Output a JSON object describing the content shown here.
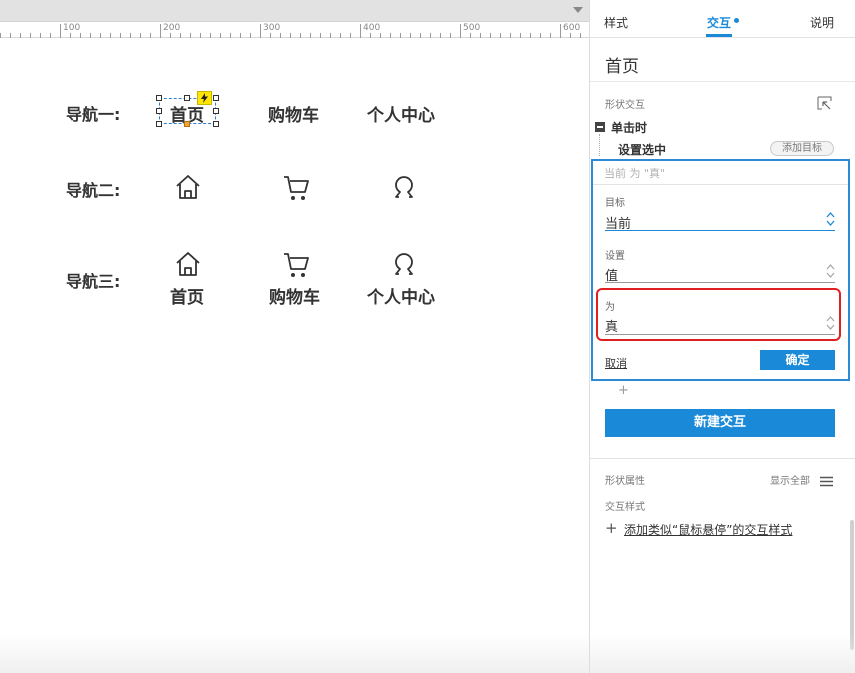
{
  "ruler": {
    "labels": [
      "100",
      "200",
      "300",
      "400",
      "500",
      "600"
    ]
  },
  "canvas": {
    "rows": [
      {
        "label": "导航一:",
        "items": [
          "首页",
          "购物车",
          "个人中心"
        ]
      },
      {
        "label": "导航二:",
        "icons": [
          "home-icon",
          "cart-icon",
          "user-icon"
        ]
      },
      {
        "label": "导航三:",
        "icons": [
          "home-icon",
          "cart-icon",
          "user-icon"
        ],
        "items": [
          "首页",
          "购物车",
          "个人中心"
        ]
      }
    ]
  },
  "panel": {
    "tabs": [
      "样式",
      "交互",
      "说明"
    ],
    "active_tab": "交互",
    "page_title": "首页",
    "shape_interactions_label": "形状交互",
    "event": {
      "label": "单击时",
      "action": "设置选中",
      "add_target": "添加目标"
    },
    "editor": {
      "summary": "当前 为 \"真\"",
      "target": {
        "label": "目标",
        "value": "当前"
      },
      "set": {
        "label": "设置",
        "value": "值"
      },
      "to": {
        "label": "为",
        "value": "真"
      },
      "cancel": "取消",
      "confirm": "确定"
    },
    "add_plus": "+",
    "new_interaction": "新建交互",
    "shape_properties": "形状属性",
    "show_all": "显示全部",
    "interaction_styles": "交互样式",
    "add_style_plus": "+",
    "add_style_link": "添加类似“鼠标悬停”的交互样式"
  },
  "colors": {
    "accent": "#1a8ad8",
    "highlight": "#e02020",
    "badge": "#ffe600"
  }
}
